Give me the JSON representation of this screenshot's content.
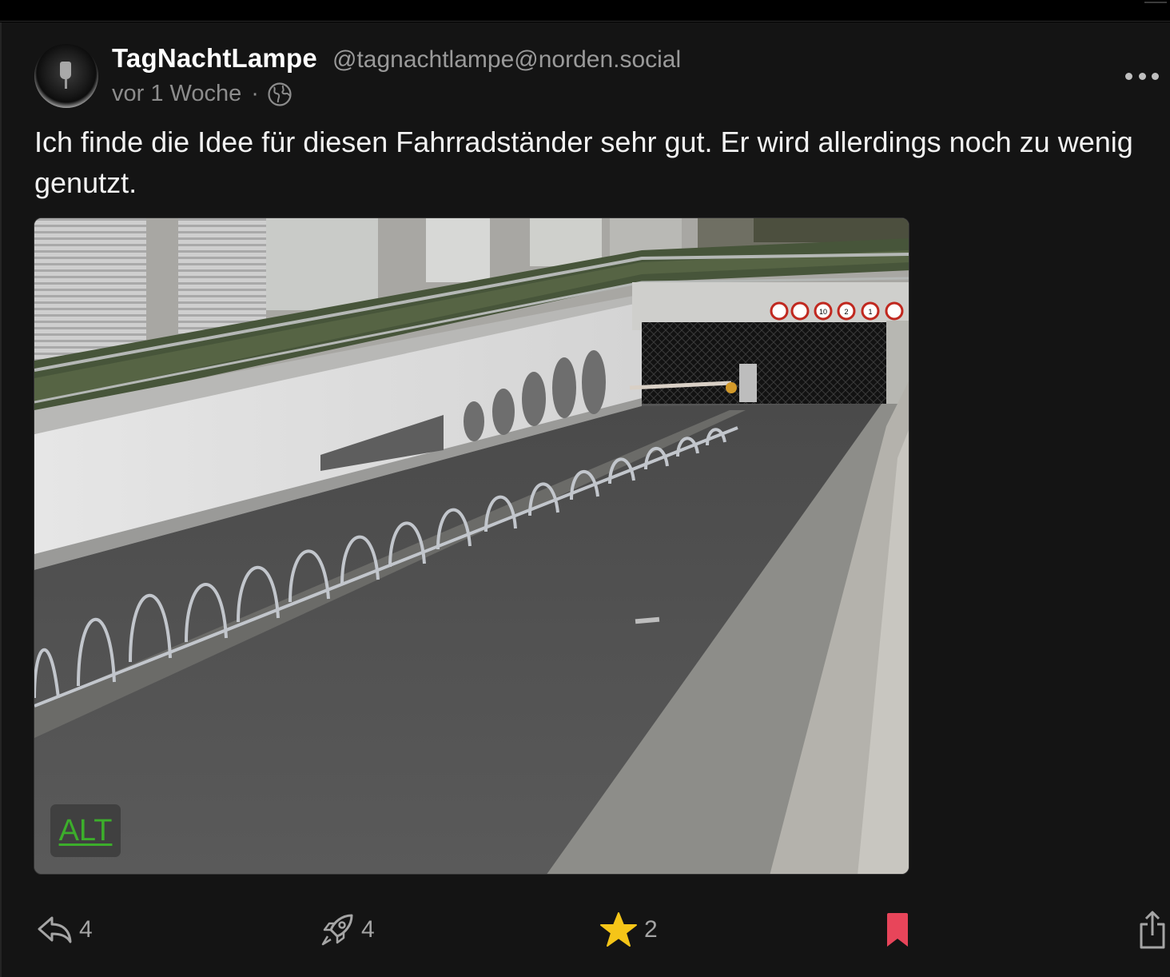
{
  "post": {
    "display_name": "TagNachtLampe",
    "handle": "@tagnachtlampe@norden.social",
    "timestamp": "vor 1 Woche",
    "separator": "·",
    "visibility_icon": "globe-icon",
    "text": "Ich finde die Idee für diesen Fahrradständer sehr gut. Er wird allerdings noch zu wenig genutzt.",
    "media": {
      "alt_label": "ALT",
      "sign_10": "10",
      "sign_2": "2",
      "sign_1": "1"
    }
  },
  "actions": {
    "reply_count": "4",
    "boost_count": "4",
    "favourite_count": "2"
  },
  "colors": {
    "background": "#141414",
    "star": "#f5c518",
    "bookmark": "#e8455a",
    "alt_text": "#3cae2b"
  }
}
